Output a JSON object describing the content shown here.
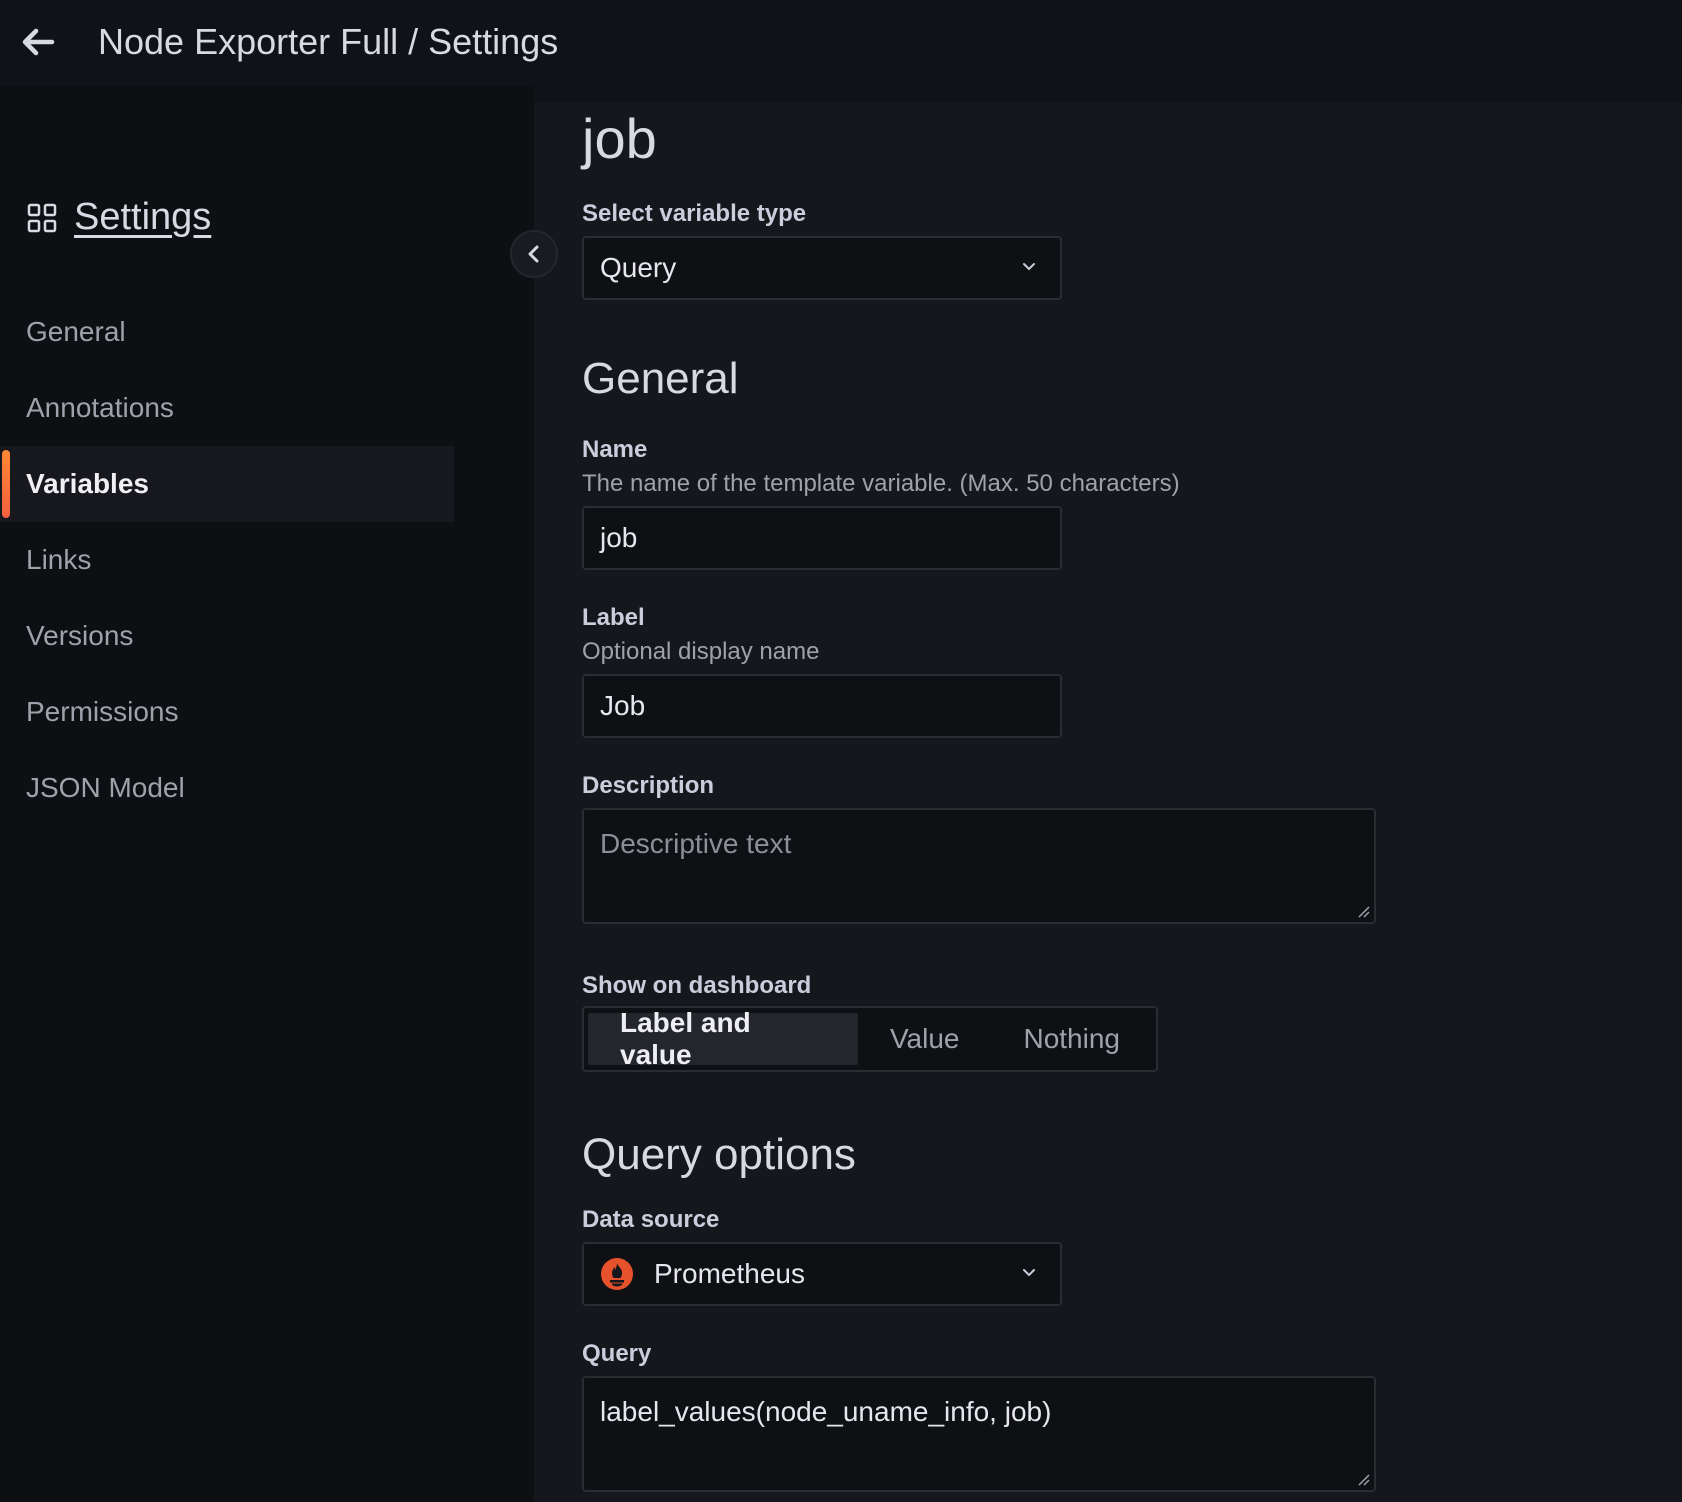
{
  "header": {
    "breadcrumb": "Node Exporter Full / Settings"
  },
  "sidebar": {
    "title": "Settings",
    "items": [
      {
        "label": "General",
        "active": false
      },
      {
        "label": "Annotations",
        "active": false
      },
      {
        "label": "Variables",
        "active": true
      },
      {
        "label": "Links",
        "active": false
      },
      {
        "label": "Versions",
        "active": false
      },
      {
        "label": "Permissions",
        "active": false
      },
      {
        "label": "JSON Model",
        "active": false
      }
    ]
  },
  "main": {
    "variable_title": "job",
    "variable_type": {
      "label": "Select variable type",
      "value": "Query"
    },
    "general": {
      "title": "General",
      "name": {
        "label": "Name",
        "description": "The name of the template variable. (Max. 50 characters)",
        "value": "job"
      },
      "label": {
        "label": "Label",
        "description": "Optional display name",
        "value": "Job"
      },
      "description": {
        "label": "Description",
        "placeholder": "Descriptive text"
      },
      "show_on_dashboard": {
        "label": "Show on dashboard",
        "options": [
          "Label and value",
          "Value",
          "Nothing"
        ],
        "selected": "Label and value"
      }
    },
    "query_options": {
      "title": "Query options",
      "data_source": {
        "label": "Data source",
        "value": "Prometheus",
        "icon": "prometheus-icon"
      },
      "query": {
        "label": "Query",
        "value": "label_values(node_uname_info, job)"
      }
    }
  },
  "colors": {
    "accent": "#f55f3e",
    "prometheus": "#e6522c"
  }
}
